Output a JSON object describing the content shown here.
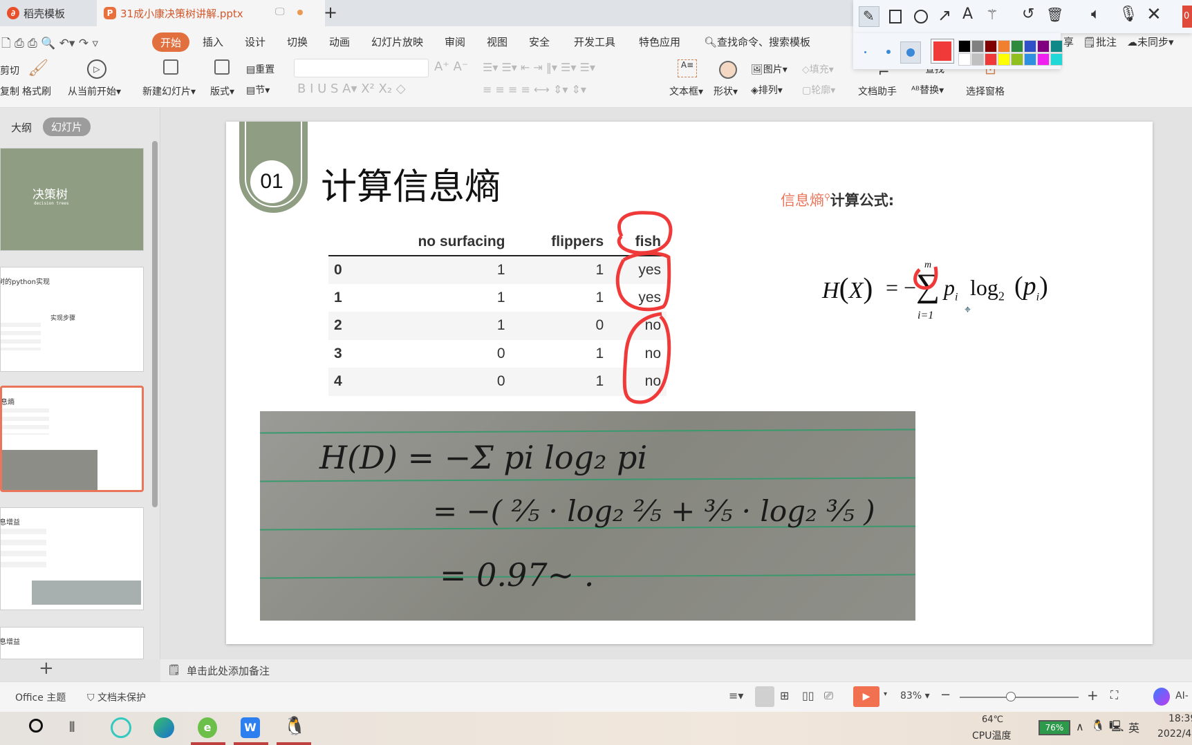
{
  "tabs": [
    {
      "label": "稻壳模板",
      "active": false
    },
    {
      "label": "31成小康决策树讲解.pptx",
      "active": true
    }
  ],
  "new_tab": "+",
  "menu": {
    "home": "开始",
    "items": [
      "插入",
      "设计",
      "切换",
      "动画",
      "幻灯片放映",
      "审阅",
      "视图",
      "安全",
      "开发工具",
      "特色应用"
    ],
    "search": "查找命令、搜索模板"
  },
  "ribbon": {
    "cut": "剪切",
    "copy": "复制",
    "format_painter": "格式刷",
    "play_from_current": "从当前开始",
    "new_slide": "新建幻灯片",
    "layout": "版式",
    "reset": "重置",
    "section": "节",
    "textbox": "文本框",
    "shape": "形状",
    "picture": "图片",
    "arrange": "排列",
    "fill": "填充",
    "outline": "轮廓",
    "doc_assistant": "文档助手",
    "find": "查找",
    "replace": "替换",
    "select_pane": "选择窗格",
    "share": "享",
    "comment": "批注",
    "sync": "未同步"
  },
  "annotation_toolbar": {
    "tools": [
      "pencil-icon",
      "rectangle-icon",
      "circle-icon",
      "arrow-icon",
      "text-icon",
      "magic-wand-icon",
      "undo-icon",
      "trash-icon",
      "speaker-icon",
      "mic-icon",
      "close-icon"
    ],
    "badge": "0",
    "selected_color": "#f03a3a",
    "palette": [
      "#000000",
      "#808080",
      "#800000",
      "#f08030",
      "#2e8b3e",
      "#3050c8",
      "#800080",
      "#108888",
      "#ffffff",
      "#c0c0c0",
      "#f03a3a",
      "#ffff00",
      "#90c020",
      "#3090e0",
      "#f020f0",
      "#20d8d8"
    ]
  },
  "leftpane": {
    "outline_tab": "大纲",
    "slides_tab": "幻灯片",
    "thumb1_title": "决策树",
    "thumb1_subtitle": "decision trees",
    "thumb2_title": "树的python实现",
    "thumb2_steps": "实现步骤",
    "thumb3_title": "息熵",
    "thumb4_title": "息增益",
    "thumb5_title": "息增益",
    "add": "+"
  },
  "slide": {
    "number": "01",
    "title": "计算信息熵",
    "formula_label_red": "信息熵",
    "formula_label": "计算公式:",
    "formula": {
      "lhs": "H",
      "arg": "X",
      "eq": "= −",
      "sum": "∑",
      "upper": "m",
      "lower": "i=1",
      "p": "p",
      "sub": "i",
      "log": "log",
      "base": "2"
    },
    "table": {
      "headers": [
        "",
        "no surfacing",
        "flippers",
        "fish"
      ],
      "rows": [
        [
          "0",
          "1",
          "1",
          "yes"
        ],
        [
          "1",
          "1",
          "1",
          "yes"
        ],
        [
          "2",
          "1",
          "0",
          "no"
        ],
        [
          "3",
          "0",
          "1",
          "no"
        ],
        [
          "4",
          "0",
          "1",
          "no"
        ]
      ]
    },
    "handwriting": [
      "H(D) = −Σ pi log₂ pi",
      "= −( ⅖ · log₂ ⅖ + ⅗ · log₂ ⅗ )",
      "= 0.97~ ."
    ],
    "annotation_color": "#f03a3a"
  },
  "notes_placeholder": "单击此处添加备注",
  "status": {
    "theme": "Office 主题",
    "protect": "文档未保护",
    "zoom": "83%",
    "zoom_level": 83,
    "ai": "AI-"
  },
  "taskbar": {
    "temp": "64℃",
    "temp_label": "CPU温度",
    "battery": "76%",
    "ime": "英",
    "time": "18:39",
    "date": "2022/4"
  }
}
